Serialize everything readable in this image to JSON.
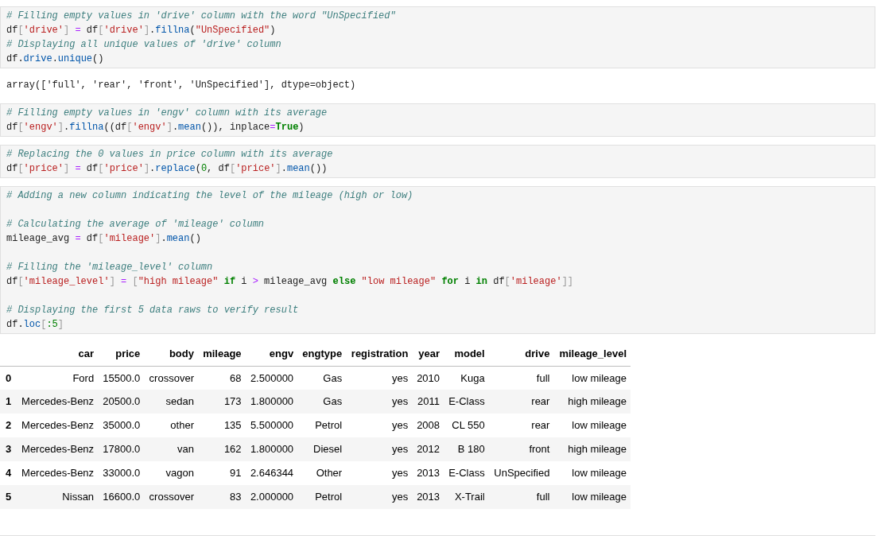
{
  "cells": [
    {
      "kind": "code",
      "blocks": [
        {
          "lines": [
            {
              "tokens": [
                {
                  "kind": "comment",
                  "text": "# Filling empty values in 'drive' column with the word \"UnSpecified\""
                }
              ]
            },
            {
              "tokens": [
                {
                  "kind": "plain",
                  "text": "df"
                },
                {
                  "kind": "punct",
                  "text": "["
                },
                {
                  "kind": "string",
                  "text": "'drive'"
                },
                {
                  "kind": "punct",
                  "text": "] "
                },
                {
                  "kind": "op",
                  "text": "="
                },
                {
                  "kind": "plain",
                  "text": " df"
                },
                {
                  "kind": "punct",
                  "text": "["
                },
                {
                  "kind": "string",
                  "text": "'drive'"
                },
                {
                  "kind": "punct",
                  "text": "]"
                },
                {
                  "kind": "plain",
                  "text": "."
                },
                {
                  "kind": "func",
                  "text": "fillna"
                },
                {
                  "kind": "plain",
                  "text": "("
                },
                {
                  "kind": "string",
                  "text": "\"UnSpecified\""
                },
                {
                  "kind": "plain",
                  "text": ")"
                }
              ]
            },
            {
              "tokens": [
                {
                  "kind": "comment",
                  "text": "# Displaying all unique values of 'drive' column"
                }
              ]
            },
            {
              "tokens": [
                {
                  "kind": "plain",
                  "text": "df."
                },
                {
                  "kind": "func",
                  "text": "drive"
                },
                {
                  "kind": "plain",
                  "text": "."
                },
                {
                  "kind": "func",
                  "text": "unique"
                },
                {
                  "kind": "plain",
                  "text": "()"
                }
              ]
            }
          ]
        }
      ]
    },
    {
      "kind": "output",
      "text": "array(['full', 'rear', 'front', 'UnSpecified'], dtype=object)"
    },
    {
      "kind": "code",
      "blocks": [
        {
          "lines": [
            {
              "tokens": [
                {
                  "kind": "comment",
                  "text": "# Filling empty values in 'engv' column with its average"
                }
              ]
            },
            {
              "tokens": [
                {
                  "kind": "plain",
                  "text": "df"
                },
                {
                  "kind": "punct",
                  "text": "["
                },
                {
                  "kind": "string",
                  "text": "'engv'"
                },
                {
                  "kind": "punct",
                  "text": "]"
                },
                {
                  "kind": "plain",
                  "text": "."
                },
                {
                  "kind": "func",
                  "text": "fillna"
                },
                {
                  "kind": "plain",
                  "text": "((df"
                },
                {
                  "kind": "punct",
                  "text": "["
                },
                {
                  "kind": "string",
                  "text": "'engv'"
                },
                {
                  "kind": "punct",
                  "text": "]"
                },
                {
                  "kind": "plain",
                  "text": "."
                },
                {
                  "kind": "func",
                  "text": "mean"
                },
                {
                  "kind": "plain",
                  "text": "()), inplace"
                },
                {
                  "kind": "op",
                  "text": "="
                },
                {
                  "kind": "keyword",
                  "text": "True"
                },
                {
                  "kind": "plain",
                  "text": ")"
                }
              ]
            }
          ]
        }
      ]
    },
    {
      "kind": "code",
      "blocks": [
        {
          "lines": [
            {
              "tokens": [
                {
                  "kind": "comment",
                  "text": "# Replacing the 0 values in price column with its average"
                }
              ]
            },
            {
              "tokens": [
                {
                  "kind": "plain",
                  "text": "df"
                },
                {
                  "kind": "punct",
                  "text": "["
                },
                {
                  "kind": "string",
                  "text": "'price'"
                },
                {
                  "kind": "punct",
                  "text": "] "
                },
                {
                  "kind": "op",
                  "text": "="
                },
                {
                  "kind": "plain",
                  "text": " df"
                },
                {
                  "kind": "punct",
                  "text": "["
                },
                {
                  "kind": "string",
                  "text": "'price'"
                },
                {
                  "kind": "punct",
                  "text": "]"
                },
                {
                  "kind": "plain",
                  "text": "."
                },
                {
                  "kind": "func",
                  "text": "replace"
                },
                {
                  "kind": "plain",
                  "text": "("
                },
                {
                  "kind": "number",
                  "text": "0"
                },
                {
                  "kind": "plain",
                  "text": ", df"
                },
                {
                  "kind": "punct",
                  "text": "["
                },
                {
                  "kind": "string",
                  "text": "'price'"
                },
                {
                  "kind": "punct",
                  "text": "]"
                },
                {
                  "kind": "plain",
                  "text": "."
                },
                {
                  "kind": "func",
                  "text": "mean"
                },
                {
                  "kind": "plain",
                  "text": "())"
                }
              ]
            }
          ]
        }
      ]
    },
    {
      "kind": "code",
      "blocks": [
        {
          "lines": [
            {
              "tokens": [
                {
                  "kind": "comment",
                  "text": "# Adding a new column indicating the level of the mileage (high or low)"
                }
              ]
            }
          ]
        },
        {
          "lines": [
            {
              "tokens": [
                {
                  "kind": "comment",
                  "text": "# Calculating the average of 'mileage' column"
                }
              ]
            },
            {
              "tokens": [
                {
                  "kind": "plain",
                  "text": "mileage_avg "
                },
                {
                  "kind": "op",
                  "text": "="
                },
                {
                  "kind": "plain",
                  "text": " df"
                },
                {
                  "kind": "punct",
                  "text": "["
                },
                {
                  "kind": "string",
                  "text": "'mileage'"
                },
                {
                  "kind": "punct",
                  "text": "]"
                },
                {
                  "kind": "plain",
                  "text": "."
                },
                {
                  "kind": "func",
                  "text": "mean"
                },
                {
                  "kind": "plain",
                  "text": "()"
                }
              ]
            }
          ]
        },
        {
          "lines": [
            {
              "tokens": [
                {
                  "kind": "comment",
                  "text": "# Filling the 'mileage_level' column"
                }
              ]
            },
            {
              "tokens": [
                {
                  "kind": "plain",
                  "text": "df"
                },
                {
                  "kind": "punct",
                  "text": "["
                },
                {
                  "kind": "string",
                  "text": "'mileage_level'"
                },
                {
                  "kind": "punct",
                  "text": "] "
                },
                {
                  "kind": "op",
                  "text": "="
                },
                {
                  "kind": "punct",
                  "text": " ["
                },
                {
                  "kind": "string",
                  "text": "\"high mileage\" "
                },
                {
                  "kind": "keyword",
                  "text": "if"
                },
                {
                  "kind": "plain",
                  "text": " i "
                },
                {
                  "kind": "op",
                  "text": ">"
                },
                {
                  "kind": "plain",
                  "text": " mileage_avg "
                },
                {
                  "kind": "keyword",
                  "text": "else"
                },
                {
                  "kind": "string",
                  "text": " \"low mileage\" "
                },
                {
                  "kind": "keyword",
                  "text": "for"
                },
                {
                  "kind": "plain",
                  "text": " i "
                },
                {
                  "kind": "keyword",
                  "text": "in"
                },
                {
                  "kind": "plain",
                  "text": " df"
                },
                {
                  "kind": "punct",
                  "text": "["
                },
                {
                  "kind": "string",
                  "text": "'mileage'"
                },
                {
                  "kind": "punct",
                  "text": "]]"
                }
              ]
            }
          ]
        },
        {
          "lines": [
            {
              "tokens": [
                {
                  "kind": "comment",
                  "text": "# Displaying the first 5 data raws to verify result"
                }
              ]
            },
            {
              "tokens": [
                {
                  "kind": "plain",
                  "text": "df."
                },
                {
                  "kind": "func",
                  "text": "loc"
                },
                {
                  "kind": "punct",
                  "text": "["
                },
                {
                  "kind": "number",
                  "text": ":5"
                },
                {
                  "kind": "punct",
                  "text": "]"
                }
              ]
            }
          ]
        }
      ]
    },
    {
      "kind": "table",
      "columns": [
        "car",
        "price",
        "body",
        "mileage",
        "engv",
        "engtype",
        "registration",
        "year",
        "model",
        "drive",
        "mileage_level"
      ],
      "rows": [
        {
          "index": "0",
          "cells": [
            "Ford",
            "15500.0",
            "crossover",
            "68",
            "2.500000",
            "Gas",
            "yes",
            "2010",
            "Kuga",
            "full",
            "low mileage"
          ]
        },
        {
          "index": "1",
          "cells": [
            "Mercedes-Benz",
            "20500.0",
            "sedan",
            "173",
            "1.800000",
            "Gas",
            "yes",
            "2011",
            "E-Class",
            "rear",
            "high mileage"
          ]
        },
        {
          "index": "2",
          "cells": [
            "Mercedes-Benz",
            "35000.0",
            "other",
            "135",
            "5.500000",
            "Petrol",
            "yes",
            "2008",
            "CL 550",
            "rear",
            "low mileage"
          ]
        },
        {
          "index": "3",
          "cells": [
            "Mercedes-Benz",
            "17800.0",
            "van",
            "162",
            "1.800000",
            "Diesel",
            "yes",
            "2012",
            "B 180",
            "front",
            "high mileage"
          ]
        },
        {
          "index": "4",
          "cells": [
            "Mercedes-Benz",
            "33000.0",
            "vagon",
            "91",
            "2.646344",
            "Other",
            "yes",
            "2013",
            "E-Class",
            "UnSpecified",
            "low mileage"
          ]
        },
        {
          "index": "5",
          "cells": [
            "Nissan",
            "16600.0",
            "crossover",
            "83",
            "2.000000",
            "Petrol",
            "yes",
            "2013",
            "X-Trail",
            "full",
            "low mileage"
          ]
        }
      ]
    }
  ]
}
